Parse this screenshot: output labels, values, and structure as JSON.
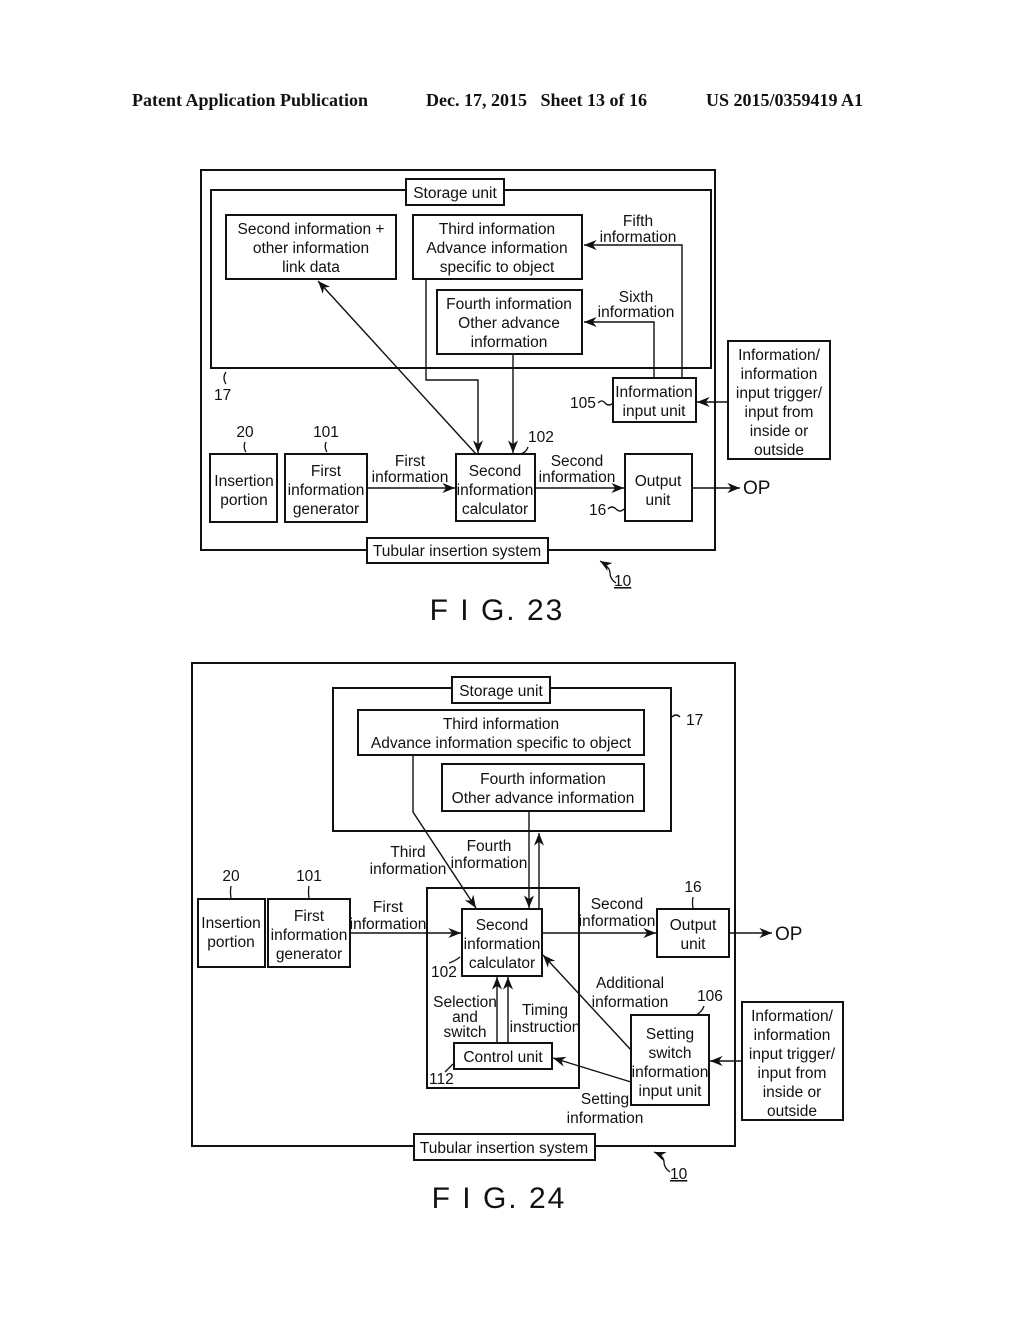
{
  "header": {
    "publication": "Patent Application Publication",
    "date_sheet": "Dec. 17, 2015   Sheet 13 of 16",
    "number": "US 2015/0359419 A1"
  },
  "fig23": {
    "caption": "F I G. 23",
    "system_label": "Tubular insertion system",
    "system_ref": "10",
    "storage_label": "Storage unit",
    "storage_ref": "17",
    "link_data": [
      "Second information +",
      "other information",
      "link data"
    ],
    "third_info": [
      "Third information",
      "Advance information",
      "specific to object"
    ],
    "fourth_info": [
      "Fourth information",
      "Other advance",
      "information"
    ],
    "fifth_label": [
      "Fifth",
      "information"
    ],
    "sixth_label": [
      "Sixth",
      "information"
    ],
    "info_input_unit": [
      "Information",
      "input unit"
    ],
    "info_input_ref": "105",
    "external": [
      "Information/",
      "information",
      "input trigger/",
      "input from",
      "inside or",
      "outside"
    ],
    "insertion": [
      "Insertion",
      "portion"
    ],
    "insertion_ref": "20",
    "first_gen": [
      "First",
      "information",
      "generator"
    ],
    "first_gen_ref": "101",
    "first_label": [
      "First",
      "information"
    ],
    "calculator": [
      "Second",
      "information",
      "calculator"
    ],
    "calculator_ref": "102",
    "second_label": [
      "Second",
      "information"
    ],
    "output": [
      "Output",
      "unit"
    ],
    "output_ref": "16",
    "op": "OP"
  },
  "fig24": {
    "caption": "F I G. 24",
    "system_label": "Tubular insertion system",
    "system_ref": "10",
    "storage_label": "Storage unit",
    "storage_ref": "17",
    "third_info": [
      "Third information",
      "Advance information specific to object"
    ],
    "fourth_info": [
      "Fourth information",
      "Other advance information"
    ],
    "third_label": [
      "Third",
      "information"
    ],
    "fourth_label": [
      "Fourth",
      "information"
    ],
    "insertion": [
      "Insertion",
      "portion"
    ],
    "insertion_ref": "20",
    "first_gen": [
      "First",
      "information",
      "generator"
    ],
    "first_gen_ref": "101",
    "first_label": [
      "First",
      "information"
    ],
    "calculator": [
      "Second",
      "information",
      "calculator"
    ],
    "calculator_ref": "102",
    "second_label": [
      "Second",
      "information"
    ],
    "output": [
      "Output",
      "unit"
    ],
    "output_ref": "16",
    "op": "OP",
    "selection_label": [
      "Selection",
      "and",
      "switch"
    ],
    "timing_label": [
      "Timing",
      "instruction"
    ],
    "control_unit": "Control unit",
    "control_ref": "112",
    "additional_label": [
      "Additional",
      "information"
    ],
    "setting_label": [
      "Setting",
      "information"
    ],
    "setting_switch": [
      "Setting",
      "switch",
      "information",
      "input unit"
    ],
    "setting_switch_ref": "106",
    "external": [
      "Information/",
      "information",
      "input trigger/",
      "input from",
      "inside or",
      "outside"
    ]
  }
}
